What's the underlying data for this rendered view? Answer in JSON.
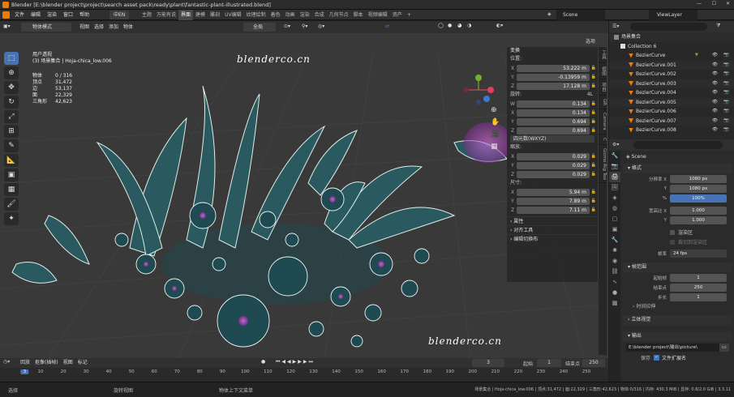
{
  "window": {
    "title": "Blender [E:\\blender project\\project\\search asset pack\\ready\\plant\\fantastic-plant-illustrated.blend]"
  },
  "menu": {
    "items": [
      "文件",
      "编辑",
      "渲染",
      "窗口",
      "帮助"
    ],
    "lang": "中EN"
  },
  "workspaces": [
    "主题",
    "万能有说",
    "界面",
    "建模",
    "雕刻",
    "UV编辑",
    "纹理绘制",
    "着色",
    "动画",
    "渲染",
    "合成",
    "几何节点",
    "脚本",
    "视频编辑",
    "资产",
    "+"
  ],
  "topright": {
    "scene": "Scene",
    "viewlayer": "ViewLayer"
  },
  "viewport_header": {
    "mode": "物体模式",
    "menus": [
      "视图",
      "选择",
      "添加",
      "物体"
    ],
    "transform": "全局",
    "options": "选项"
  },
  "viewport_info": {
    "view": "用户透视",
    "collection": "(3) 场景集合 | Hoja-chica_low.006"
  },
  "stats": [
    {
      "label": "物体",
      "value": "0 / 316"
    },
    {
      "label": "顶点",
      "value": "31,472"
    },
    {
      "label": "边",
      "value": "53,137"
    },
    {
      "label": "面",
      "value": "22,329"
    },
    {
      "label": "三角形",
      "value": "42,623"
    }
  ],
  "watermark": {
    "top": "blenderco.cn",
    "bottom": "blenderco.cn"
  },
  "npanel": {
    "transform_title": "变换",
    "location_label": "位置:",
    "location": [
      {
        "ax": "X",
        "v": "53.222 m"
      },
      {
        "ax": "Y",
        "v": "-0.13959 m"
      },
      {
        "ax": "Z",
        "v": "17.128 m"
      }
    ],
    "rotation_label": "旋转:",
    "rotation_mode_tag": "4L",
    "rotation": [
      {
        "ax": "W",
        "v": "0.134"
      },
      {
        "ax": "X",
        "v": "0.134"
      },
      {
        "ax": "Y",
        "v": "0.694"
      },
      {
        "ax": "Z",
        "v": "0.694"
      }
    ],
    "rotation_mode": "四元数(WXYZ)",
    "scale_label": "缩放:",
    "scale": [
      {
        "ax": "X",
        "v": "0.029"
      },
      {
        "ax": "Y",
        "v": "0.029"
      },
      {
        "ax": "Z",
        "v": "0.029"
      }
    ],
    "dimensions_label": "尺寸:",
    "dimensions": [
      {
        "ax": "X",
        "v": "5.94 m"
      },
      {
        "ax": "Y",
        "v": "7.89 m"
      },
      {
        "ax": "Z",
        "v": "7.11 m"
      }
    ],
    "sections": [
      "属性",
      "对齐工具",
      "编辑切换布"
    ]
  },
  "vtabs": [
    "工具",
    "视图",
    "项目",
    "GR",
    "Camera",
    "C",
    "Gizmo Rig Too"
  ],
  "outliner": {
    "root": "场景集合",
    "collection": "Collection 6",
    "items": [
      "BezierCurve",
      "BezierCurve.001",
      "BezierCurve.002",
      "BezierCurve.003",
      "BezierCurve.004",
      "BezierCurve.005",
      "BezierCurve.006",
      "BezierCurve.007",
      "BezierCurve.008"
    ]
  },
  "properties": {
    "scene": "Scene",
    "format_title": "格式",
    "resolution_x_label": "分辨率 X",
    "resolution_x": "1080 px",
    "resolution_y_label": "Y",
    "resolution_y": "1080 px",
    "percent_label": "%",
    "percent": "100%",
    "aspect_x_label": "宽高比 X",
    "aspect_x": "1.000",
    "aspect_y_label": "Y",
    "aspect_y": "1.000",
    "crop_label": "渲染区",
    "crop_sub": "裁切到渲染区",
    "fps_label": "帧率",
    "fps": "24 fps",
    "frame_range_title": "帧范围",
    "frame_start_label": "起始帧",
    "frame_start": "1",
    "frame_end_label": "结束点",
    "frame_end": "250",
    "step_label": "步长",
    "step": "1",
    "time_stretch": "时间拉伸",
    "stereoscopy": "立体视觉",
    "output_title": "输出",
    "output_path": "E:\\blender project\\输出\\picture\\",
    "save_label": "保存",
    "ext_label": "文件扩展名"
  },
  "timeline": {
    "menus": [
      "回放",
      "抠像(插帧)",
      "视图",
      "标记"
    ],
    "current": "3",
    "start_label": "起始",
    "start": "1",
    "end_label": "结束点",
    "end": "250",
    "ticks": [
      3,
      10,
      20,
      30,
      40,
      50,
      60,
      70,
      80,
      90,
      100,
      110,
      120,
      130,
      140,
      150,
      160,
      170,
      180,
      190,
      200,
      210,
      220,
      230,
      240,
      250
    ]
  },
  "status": {
    "left": "选择",
    "mid1": "旋转视图",
    "mid2": "物体上下文菜单",
    "right": "场景集合 | Hoja-chica_low.006 | 顶点:31,472 | 面:22,329 | 三角形:42,623 | 物体:0/316 | 内存: 430.3 MiB | 显存: 0.8/2.0 GiB | 3.3.11"
  },
  "colors": {
    "accent": "#4772b3",
    "plant": "#cfe8e0",
    "glow": "#d05fd6",
    "x_axis": "#e04060",
    "y_axis": "#70b030",
    "z_axis": "#3a7ad0"
  }
}
